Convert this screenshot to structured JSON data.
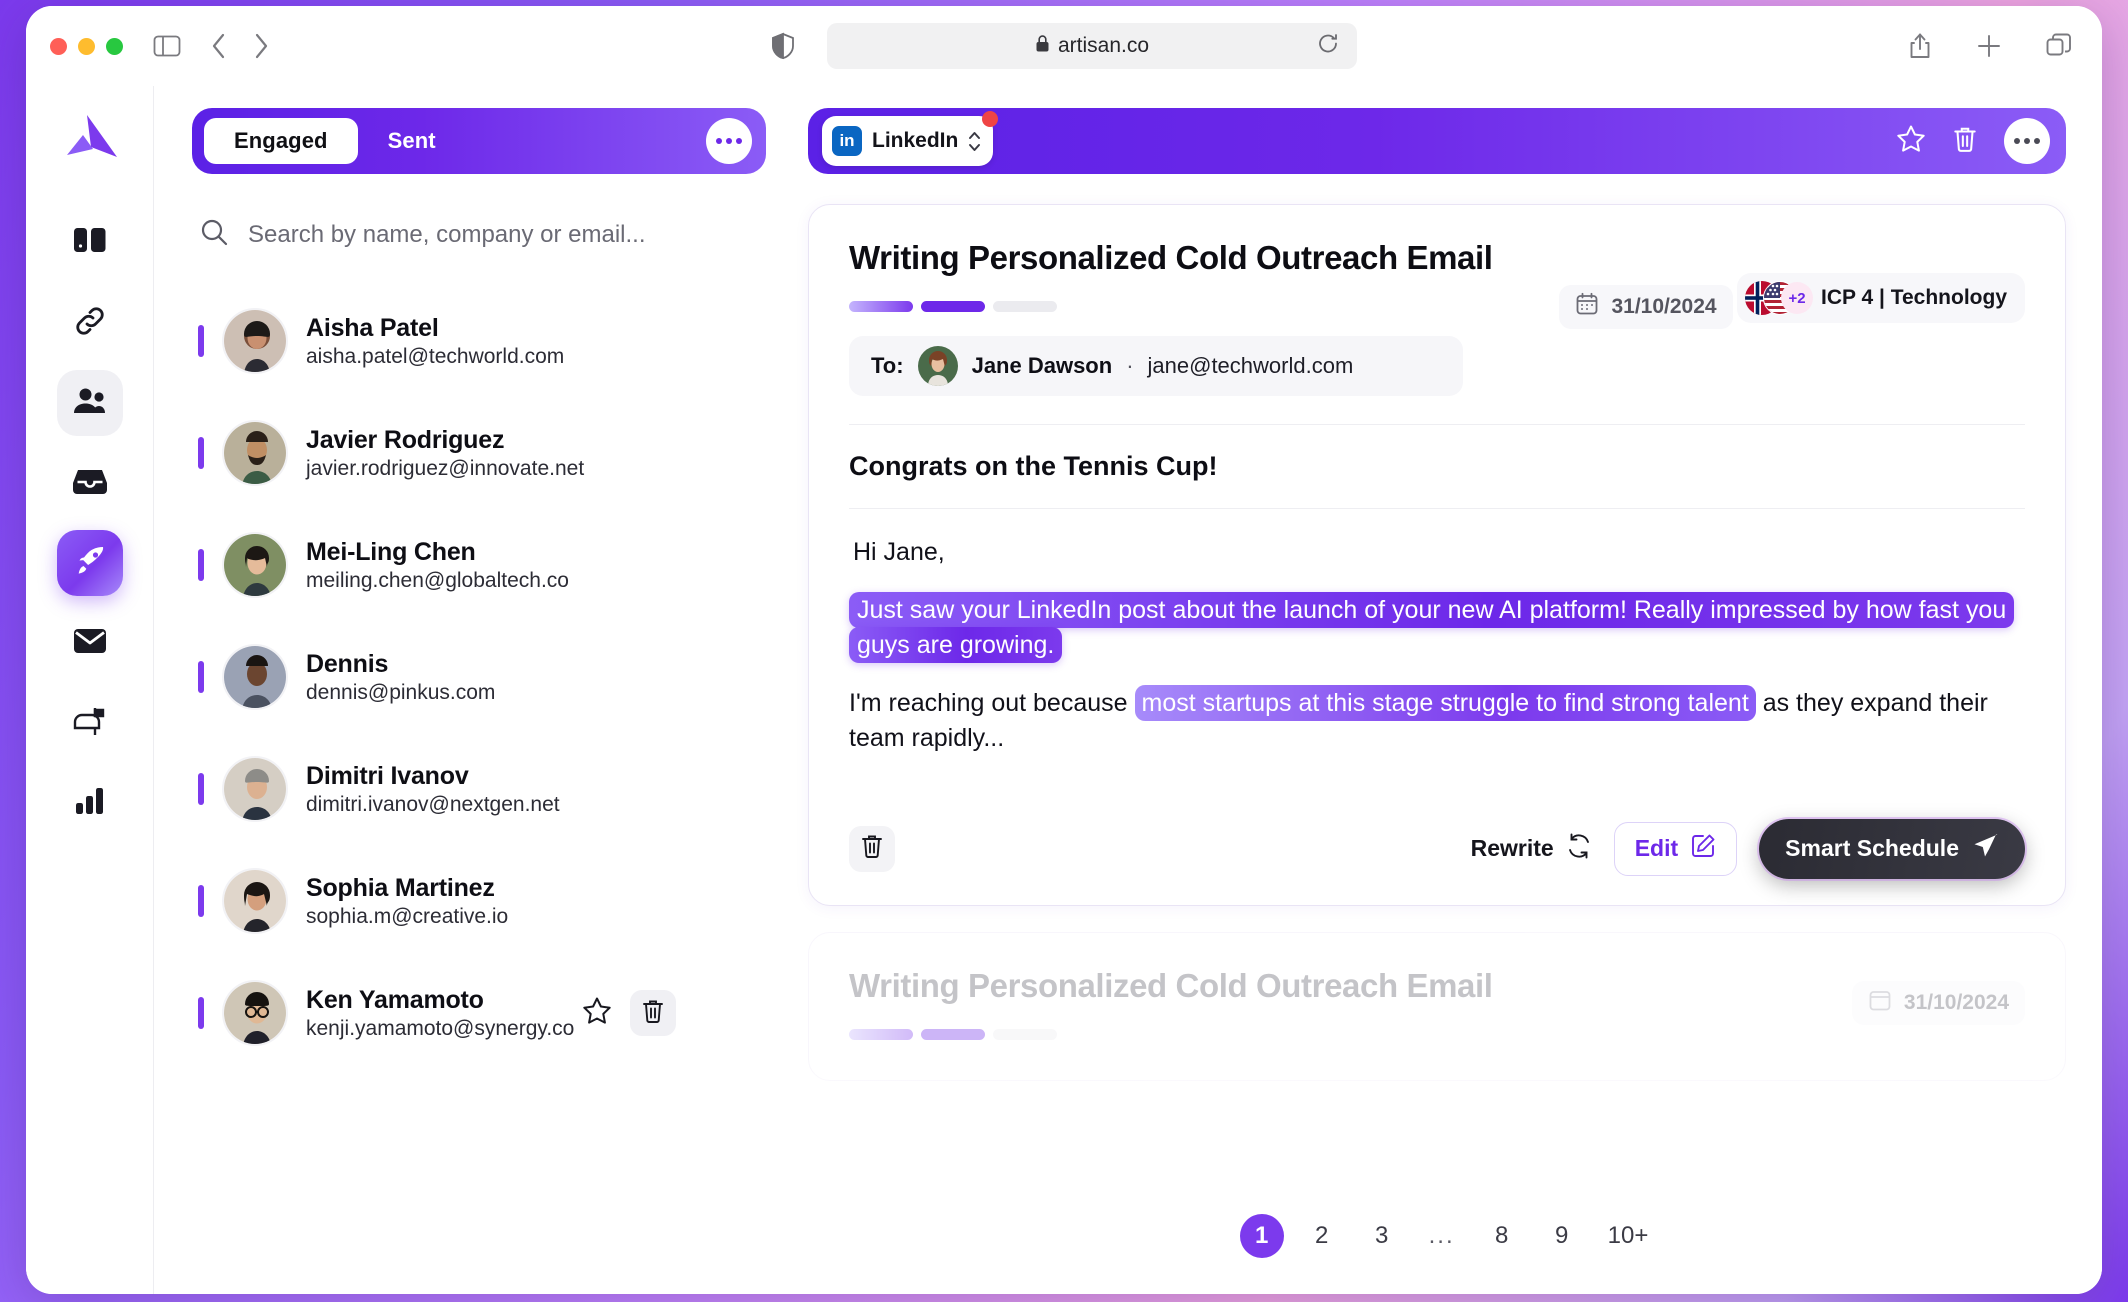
{
  "browser": {
    "url": "artisan.co",
    "lock_icon": "lock-icon",
    "reload_icon": "reload-icon",
    "share_icon": "share-icon",
    "newtab_icon": "plus-icon",
    "tabs_icon": "tab-overview-icon",
    "back_icon": "chevron-left-icon",
    "forward_icon": "chevron-right-icon",
    "sidebar_icon": "sidebar-toggle-icon",
    "shield_icon": "shield-icon"
  },
  "rail": {
    "brand": "artisan-logo",
    "items": [
      {
        "icon": "dashboard-cards-icon",
        "name": "dashboard",
        "state": "default"
      },
      {
        "icon": "link-icon",
        "name": "integrations",
        "state": "default"
      },
      {
        "icon": "people-icon",
        "name": "contacts",
        "state": "soft"
      },
      {
        "icon": "inbox-icon",
        "name": "inbox",
        "state": "default"
      },
      {
        "icon": "rocket-icon",
        "name": "campaigns",
        "state": "active"
      },
      {
        "icon": "envelope-icon",
        "name": "email",
        "state": "default"
      },
      {
        "icon": "mailbox-icon",
        "name": "mailbox",
        "state": "default"
      },
      {
        "icon": "bar-chart-icon",
        "name": "analytics",
        "state": "default"
      }
    ]
  },
  "list": {
    "tabs": [
      {
        "label": "Engaged",
        "active": true
      },
      {
        "label": "Sent",
        "active": false
      }
    ],
    "more_icon": "ellipsis-icon",
    "search": {
      "placeholder": "Search by name, company or email...",
      "value": "",
      "icon": "search-icon"
    },
    "contacts": [
      {
        "name": "Aisha Patel",
        "email": "aisha.patel@techworld.com",
        "avatar": "#b57f68"
      },
      {
        "name": "Javier Rodriguez",
        "email": "javier.rodriguez@innovate.net",
        "avatar": "#9a7352"
      },
      {
        "name": "Mei-Ling Chen",
        "email": "meiling.chen@globaltech.co",
        "avatar": "#7d8a5f"
      },
      {
        "name": "Dennis",
        "email": "dennis@pinkus.com",
        "avatar": "#6b5c52"
      },
      {
        "name": "Dimitri Ivanov",
        "email": "dimitri.ivanov@nextgen.net",
        "avatar": "#8d8378"
      },
      {
        "name": "Sophia Martinez",
        "email": "sophia.m@creative.io",
        "avatar": "#a87e66"
      },
      {
        "name": "Ken Yamamoto",
        "email": "kenji.yamamoto@synergy.co",
        "avatar": "#9c8266",
        "actions": {
          "star_icon": "star-icon",
          "delete_icon": "trash-icon"
        }
      }
    ]
  },
  "pane": {
    "channel": {
      "label": "LinkedIn",
      "icon": "linkedin-icon",
      "badge": "notification-dot",
      "selector_icon": "up-down-chevron-icon"
    },
    "header_actions": {
      "star_icon": "star-icon",
      "trash_icon": "trash-icon",
      "more_icon": "ellipsis-icon"
    },
    "card": {
      "title": "Writing Personalized Cold Outreach Email",
      "progress": {
        "steps": 3,
        "completed": 2
      },
      "date": "31/10/2024",
      "date_icon": "calendar-icon",
      "flags_extra": "+2",
      "icp": "ICP 4 | Technology",
      "to_label": "To:",
      "to_name": "Jane Dawson",
      "to_separator": "·",
      "to_email": "jane@techworld.com",
      "subject": "Congrats on the Tennis Cup!",
      "greeting": "Hi Jane,",
      "highlight_1": "Just saw your LinkedIn post about the launch of your new AI platform! Really impressed by how fast you guys are growing.",
      "para2_pre": "I'm reaching out because ",
      "highlight_2": "most startups at this stage struggle to find strong talent",
      "para2_post": " as they expand their team rapidly...",
      "footer": {
        "delete_icon": "trash-icon",
        "rewrite_label": "Rewrite",
        "rewrite_icon": "refresh-icon",
        "edit_label": "Edit",
        "edit_icon": "pencil-square-icon",
        "schedule_label": "Smart Schedule",
        "schedule_icon": "send-icon"
      }
    },
    "ghost_card": {
      "title": "Writing Personalized Cold Outreach Email",
      "date": "31/10/2024"
    },
    "pagination": [
      {
        "label": "1",
        "active": true
      },
      {
        "label": "2",
        "active": false
      },
      {
        "label": "3",
        "active": false
      },
      {
        "label": "...",
        "active": false,
        "dots": true
      },
      {
        "label": "8",
        "active": false
      },
      {
        "label": "9",
        "active": false
      },
      {
        "label": "10+",
        "active": false
      }
    ]
  },
  "colors": {
    "accent": "#7C3AED",
    "accent_dark": "#5B21E6",
    "accent_light": "#A78BFA",
    "linkedin": "#0A66C2",
    "danger": "#EF4444",
    "dark_button": "#2B2B33"
  }
}
